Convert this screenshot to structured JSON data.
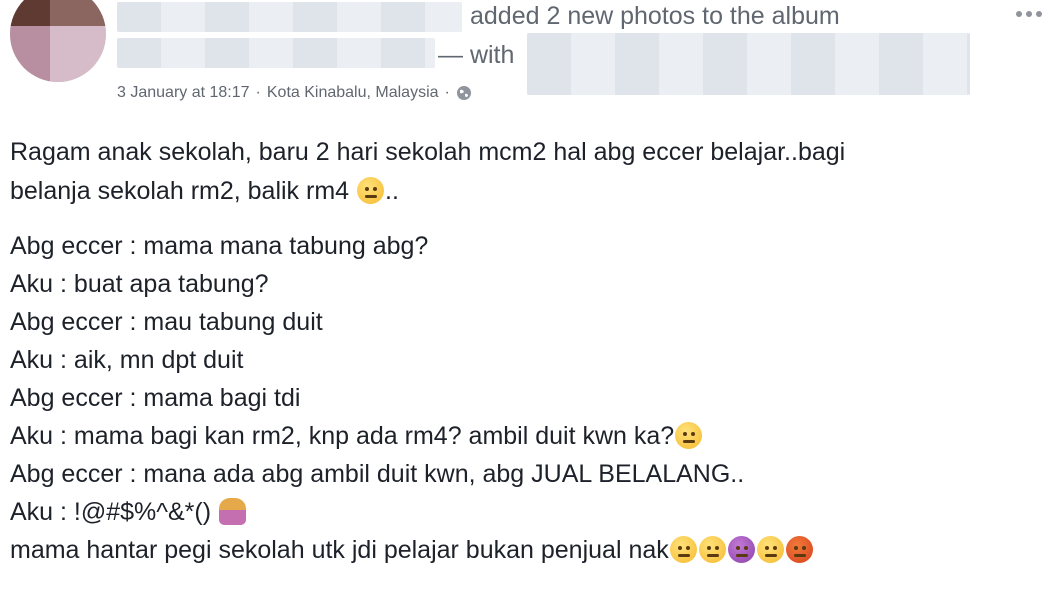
{
  "header": {
    "action_text": "added 2 new photos to the album",
    "with_text": "— with",
    "more_icon": "more-options-icon"
  },
  "meta": {
    "date": "3 January at 18:17",
    "separator1": "·",
    "location": "Kota Kinabalu, Malaysia",
    "separator2": "·",
    "privacy_icon": "globe-icon"
  },
  "post": {
    "line1": "Ragam anak sekolah, baru 2 hari sekolah mcm2 hal abg eccer belajar..bagi",
    "line2": "belanja sekolah rm2, balik rm4",
    "line2_suffix": "..",
    "line3": "Abg eccer : mama mana tabung abg?",
    "line4": "Aku : buat apa tabung?",
    "line5": "Abg eccer : mau tabung duit",
    "line6": "Aku : aik, mn dpt duit",
    "line7": "Abg eccer : mama bagi tdi",
    "line8": "Aku : mama bagi kan rm2, knp ada rm4? ambil duit kwn ka?",
    "line9": "Abg eccer : mana ada abg ambil duit kwn, abg JUAL BELALANG..",
    "line10": "Aku : !@#$%^&*()",
    "line11": "mama hantar pegi sekolah utk jdi pelajar bukan penjual nak"
  },
  "colors": {
    "text": "#1d2129",
    "secondary": "#606770",
    "blur": "#dfe3ea"
  }
}
